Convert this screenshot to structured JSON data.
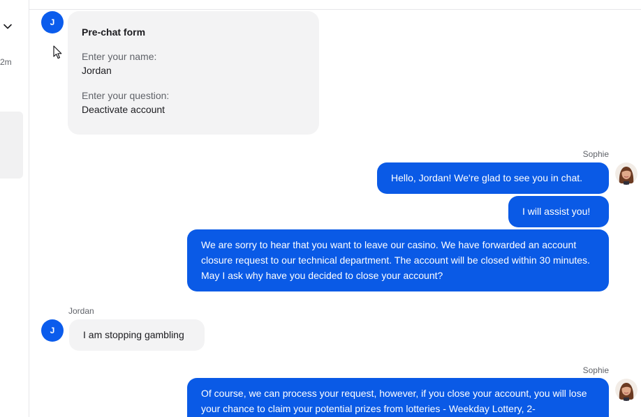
{
  "sidebar": {
    "time_label": "2m"
  },
  "prechat": {
    "avatar_initial": "J",
    "title": "Pre-chat form",
    "fields": [
      {
        "question": "Enter your name:",
        "answer": "Jordan"
      },
      {
        "question": "Enter your question:",
        "answer": "Deactivate account"
      }
    ]
  },
  "messages": [
    {
      "sender": "Sophie",
      "direction": "outgoing",
      "text": "Hello, Jordan! We're glad to see you in chat."
    },
    {
      "sender": "Sophie",
      "direction": "outgoing",
      "text": "I will assist you!"
    },
    {
      "sender": "Sophie",
      "direction": "outgoing",
      "text": "We are sorry to hear that you want to leave our casino. We have forwarded an account closure request to our technical department. The account will be closed within 30 minutes. May I ask why have you decided to close your account?"
    },
    {
      "sender": "Jordan",
      "direction": "incoming",
      "avatar_initial": "J",
      "text": "I am stopping gambling"
    },
    {
      "sender": "Sophie",
      "direction": "outgoing",
      "text": "Of course, we can process your request, however, if you close your account, you will lose your chance to claim your potential prizes from lotteries - Weekday Lottery, 2-"
    }
  ],
  "colors": {
    "agent_bubble": "#0a5ae6",
    "visitor_bubble": "#f3f3f4",
    "visitor_avatar": "#0b5cec"
  }
}
